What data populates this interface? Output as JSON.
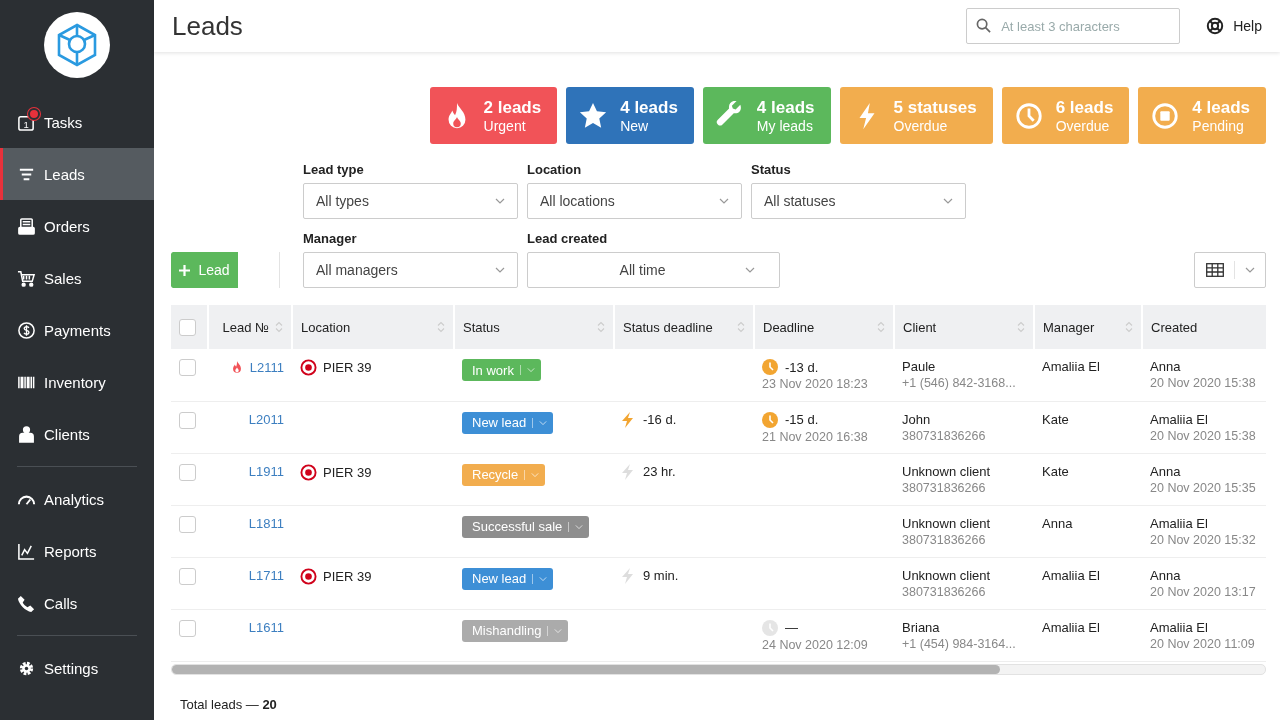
{
  "sidebar": {
    "groups": [
      [
        {
          "kind": "tasks",
          "icon_text": "1",
          "notification": true,
          "label": "Tasks",
          "selected": false
        },
        {
          "kind": "leads",
          "notification": false,
          "label": "Leads",
          "selected": true
        },
        {
          "kind": "orders",
          "notification": false,
          "label": "Orders",
          "selected": false
        },
        {
          "kind": "sales",
          "notification": false,
          "label": "Sales",
          "selected": false
        },
        {
          "kind": "payments",
          "notification": false,
          "label": "Payments",
          "selected": false
        },
        {
          "kind": "inventory",
          "notification": false,
          "label": "Inventory",
          "selected": false
        },
        {
          "kind": "clients",
          "notification": false,
          "label": "Clients",
          "selected": false
        }
      ],
      [
        {
          "kind": "analytics",
          "notification": false,
          "label": "Analytics",
          "selected": false
        },
        {
          "kind": "reports",
          "notification": false,
          "label": "Reports",
          "selected": false
        },
        {
          "kind": "calls",
          "notification": false,
          "label": "Calls",
          "selected": false
        }
      ],
      [
        {
          "kind": "settings",
          "notification": false,
          "label": "Settings",
          "selected": false
        }
      ]
    ]
  },
  "header": {
    "title": "Leads",
    "search": {
      "placeholder": "At least 3 characters"
    },
    "help": "Help"
  },
  "stat_cards": [
    {
      "kind": "flame",
      "color": "#f15358",
      "count": "2 leads",
      "label": "Urgent"
    },
    {
      "kind": "star",
      "color": "#2f73b9",
      "count": "4 leads",
      "label": "New"
    },
    {
      "kind": "wrench",
      "color": "#5cb85c",
      "count": "4 leads",
      "label": "My leads"
    },
    {
      "kind": "bolt",
      "color": "#f2ad4e",
      "count": "5 statuses",
      "label": "Overdue"
    },
    {
      "kind": "clock",
      "color": "#f2ad4e",
      "count": "6 leads",
      "label": "Overdue"
    },
    {
      "kind": "stop",
      "color": "#f2ad4e",
      "count": "4 leads",
      "label": "Pending"
    }
  ],
  "filters": {
    "rows": [
      [
        {
          "label": "Lead type",
          "value": "All types"
        },
        {
          "label": "Location",
          "value": "All locations"
        },
        {
          "label": "Status",
          "value": "All statuses"
        }
      ],
      [
        {
          "label": "Manager",
          "value": "All managers"
        },
        {
          "label": "Lead created",
          "value": "All time"
        }
      ]
    ]
  },
  "add_button": "Lead",
  "table": {
    "header_checked": false,
    "columns": [
      {
        "label": "Lead №",
        "sortable": true
      },
      {
        "label": "Location",
        "sortable": true
      },
      {
        "label": "Status",
        "sortable": true
      },
      {
        "label": "Status deadline",
        "sortable": true
      },
      {
        "label": "Deadline",
        "sortable": true
      },
      {
        "label": "Client",
        "sortable": true
      },
      {
        "label": "Manager",
        "sortable": true
      },
      {
        "label": "Created",
        "sortable": false
      }
    ],
    "rows": [
      {
        "checked": false,
        "urgent": true,
        "lead": "L2111",
        "location": "PIER 39",
        "status": {
          "label": "In work",
          "color": "#5cb85c"
        },
        "deadline": {
          "text": "-13 d.",
          "date": "23 Nov 2020 18:23",
          "overdue": true
        },
        "client": {
          "name": "Paule",
          "phone": "+1 (546) 842-3168..."
        },
        "manager": "Amaliia El",
        "created": {
          "by": "Anna",
          "date": "20 Nov 2020 15:38"
        }
      },
      {
        "checked": false,
        "urgent": false,
        "lead": "L2011",
        "status": {
          "label": "New lead",
          "color": "#3d8fd6"
        },
        "status_deadline": {
          "text": "-16 d.",
          "overdue": true
        },
        "deadline": {
          "text": "-15 d.",
          "date": "21 Nov 2020 16:38",
          "overdue": true
        },
        "client": {
          "name": "John",
          "phone": "380731836266"
        },
        "manager": "Kate",
        "created": {
          "by": "Amaliia El",
          "date": "20 Nov 2020 15:38"
        }
      },
      {
        "checked": false,
        "urgent": false,
        "lead": "L1911",
        "location": "PIER 39",
        "status": {
          "label": "Recycle",
          "color": "#f2ad4e"
        },
        "status_deadline": {
          "text": "23 hr.",
          "overdue": false
        },
        "client": {
          "name": "Unknown client",
          "phone": "380731836266"
        },
        "manager": "Kate",
        "created": {
          "by": "Anna",
          "date": "20 Nov 2020 15:35"
        }
      },
      {
        "checked": false,
        "urgent": false,
        "lead": "L1811",
        "status": {
          "label": "Successful sale",
          "color": "#8e8e8e"
        },
        "client": {
          "name": "Unknown client",
          "phone": "380731836266"
        },
        "manager": "Anna",
        "created": {
          "by": "Amaliia El",
          "date": "20 Nov 2020 15:32"
        }
      },
      {
        "checked": false,
        "urgent": false,
        "lead": "L1711",
        "location": "PIER 39",
        "status": {
          "label": "New lead",
          "color": "#3d8fd6"
        },
        "status_deadline": {
          "text": "9 min.",
          "overdue": false
        },
        "client": {
          "name": "Unknown client",
          "phone": "380731836266"
        },
        "manager": "Amaliia El",
        "created": {
          "by": "Anna",
          "date": "20 Nov 2020 13:17"
        }
      },
      {
        "checked": false,
        "urgent": false,
        "lead": "L1611",
        "status": {
          "label": "Mishandling",
          "color": "#ababab"
        },
        "deadline": {
          "text": "—",
          "date": "24 Nov 2020 12:09",
          "overdue": false
        },
        "client": {
          "name": "Briana",
          "phone": "+1 (454) 984-3164..."
        },
        "manager": "Amaliia El",
        "created": {
          "by": "Amaliia El",
          "date": "20 Nov 2020 11:09"
        }
      }
    ]
  },
  "footer": {
    "label": "Total leads — ",
    "count": "20"
  }
}
